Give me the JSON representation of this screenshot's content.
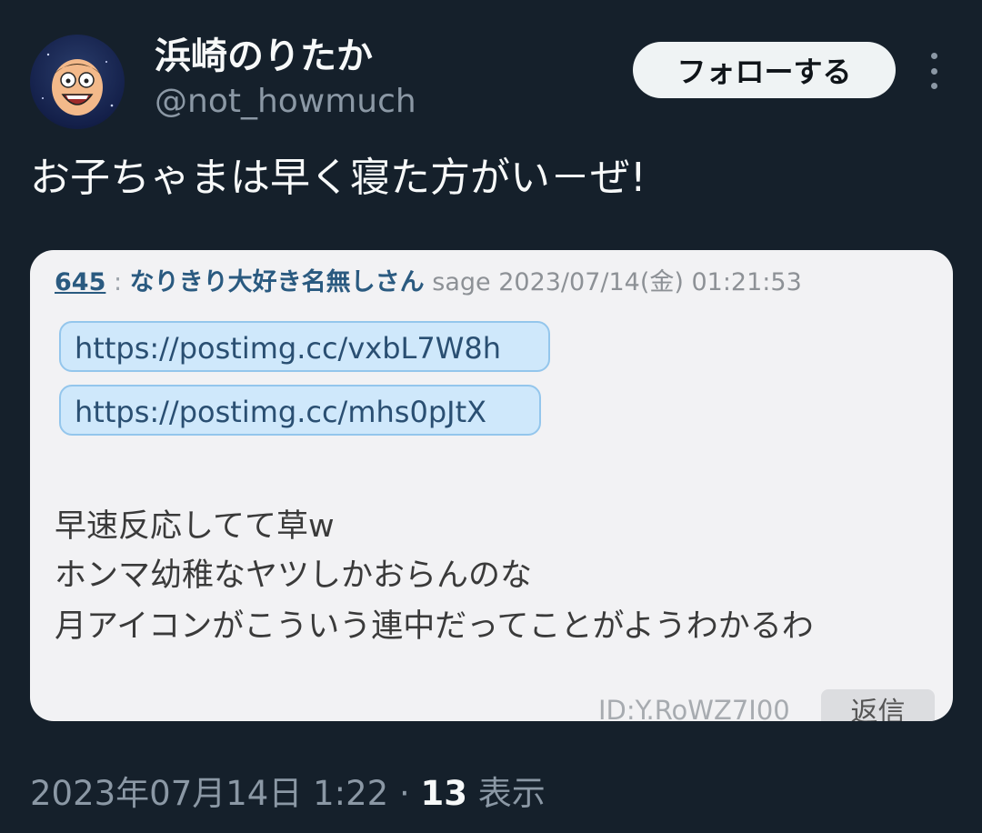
{
  "author": {
    "display_name": "浜崎のりたか",
    "handle": "@not_howmuch",
    "avatar_icon": "cartoon-face-avatar"
  },
  "actions": {
    "follow_label": "フォローする",
    "more_icon": "more-vertical-icon"
  },
  "tweet": {
    "text": "お子ちゃまは早く寝た方がい－ぜ!"
  },
  "card": {
    "post_number": "645",
    "separator": ":",
    "poster_name": "なりきり大好き名無しさん",
    "meta": "sage 2023/07/14(金) 01:21:53",
    "links": [
      "https://postimg.cc/vxbL7W8h",
      "https://postimg.cc/mhs0pJtX"
    ],
    "body_lines": [
      "早速反応してて草w",
      "ホンマ幼稚なヤツしかおらんのな",
      "月アイコンがこういう連中だってことがようわかるわ"
    ],
    "post_id": "ID:Y.RoWZ7I00",
    "reply_label": "返信"
  },
  "footer": {
    "timestamp": "2023年07月14日 1:22",
    "dot": "·",
    "view_count": "13",
    "views_label": "表示"
  },
  "colors": {
    "background": "#15202b",
    "card_background": "#f2f2f4",
    "link_chip": "#cfe8fb",
    "muted_text": "#8b98a5"
  }
}
